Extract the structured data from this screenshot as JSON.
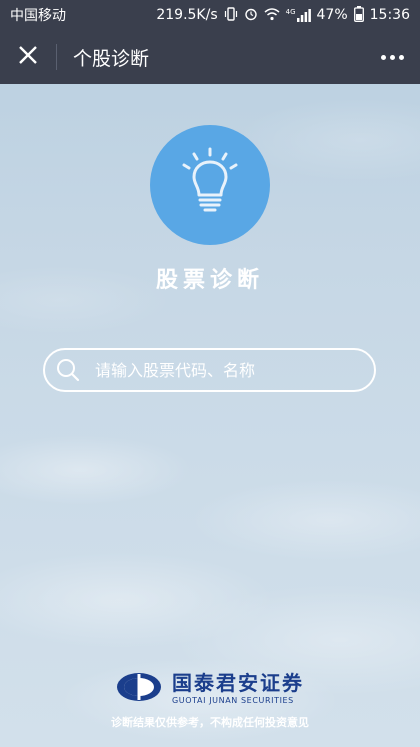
{
  "status_bar": {
    "carrier": "中国移动",
    "network_speed": "219.5K/s",
    "network_type": "4G",
    "battery": "47%",
    "time": "15:36"
  },
  "nav": {
    "title": "个股诊断"
  },
  "main": {
    "title": "股票诊断",
    "search_placeholder": "请输入股票代码、名称"
  },
  "footer": {
    "brand_cn": "国泰君安证券",
    "brand_en": "GUOTAI JUNAN SECURITIES",
    "disclaimer": "诊断结果仅供参考，不构成任何投资意见"
  },
  "colors": {
    "nav_bg": "#3a3f4d",
    "accent_circle": "#59a7e5",
    "brand_blue": "#1b3e8c"
  },
  "icons": [
    "close-icon",
    "more-icon",
    "lightbulb-icon",
    "search-icon",
    "brand-logo-icon",
    "wifi-icon",
    "signal-icon",
    "battery-icon",
    "alarm-icon",
    "vibrate-icon"
  ]
}
